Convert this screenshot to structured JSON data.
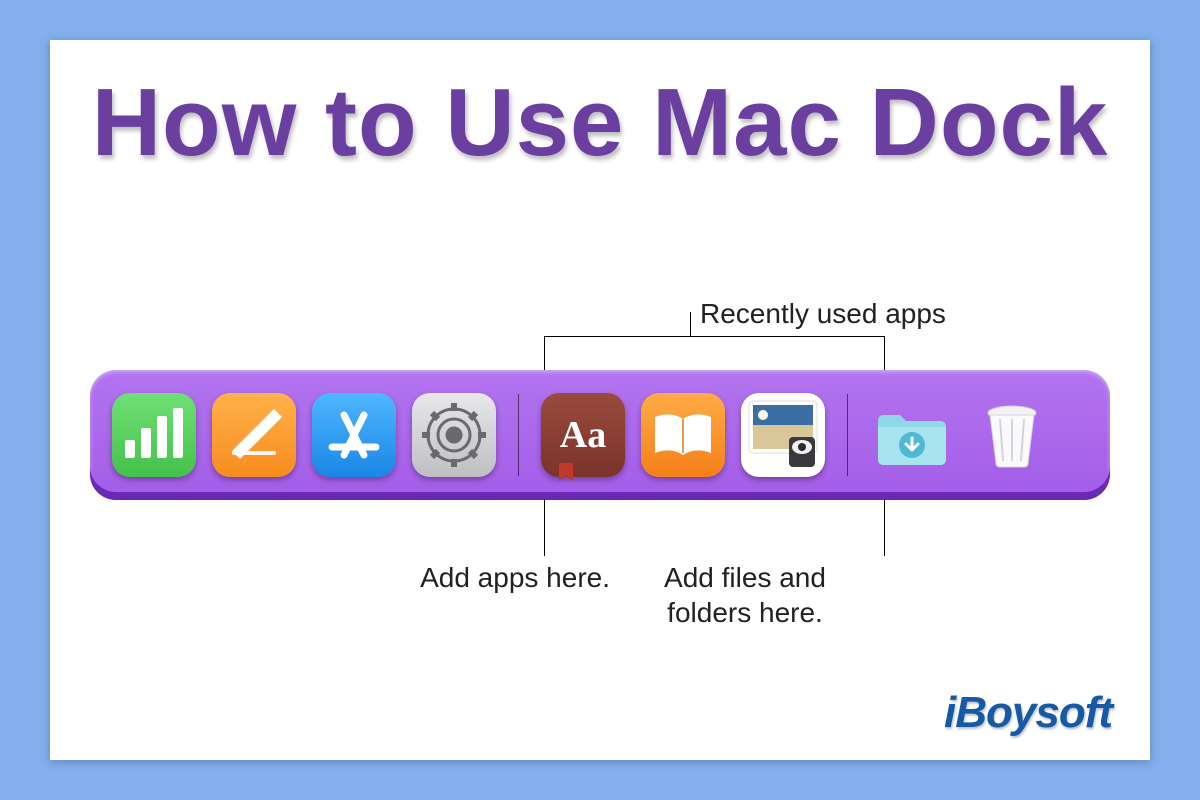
{
  "title": "How to Use Mac Dock",
  "callouts": {
    "recent": "Recently used apps",
    "add_apps": "Add apps here.",
    "add_files": "Add files and\nfolders here."
  },
  "dock": {
    "apps_section": [
      {
        "name": "numbers"
      },
      {
        "name": "pages"
      },
      {
        "name": "app-store"
      },
      {
        "name": "system-preferences"
      }
    ],
    "recent_section": [
      {
        "name": "dictionary",
        "label": "Aa"
      },
      {
        "name": "books"
      },
      {
        "name": "preview"
      }
    ],
    "files_section": [
      {
        "name": "downloads-folder"
      },
      {
        "name": "trash"
      }
    ]
  },
  "brand": "iBoysoft"
}
